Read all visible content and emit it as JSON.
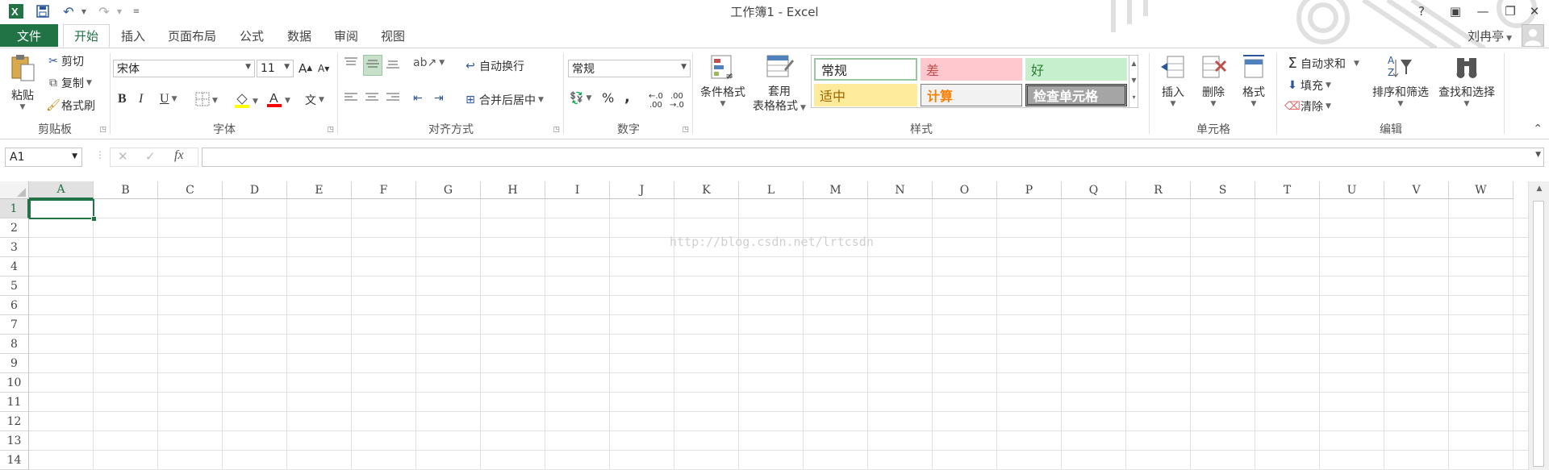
{
  "colors": {
    "accent": "#217346",
    "bad_bg": "#ffc7ce",
    "bad_fg": "#c0504d",
    "good_bg": "#c6efce",
    "neutral_bg": "#ffeb9c",
    "calc_fg": "#fa7d00",
    "check_bg": "#a5a5a5"
  },
  "quick_access": {
    "icons": [
      "excel-logo-icon",
      "save-icon",
      "undo-icon",
      "redo-icon",
      "customize-icon"
    ]
  },
  "window": {
    "title": "工作簿1 - Excel",
    "help": "?",
    "ribbon_display": "▣",
    "minimize": "—",
    "restore": "❐",
    "close": "✕"
  },
  "tabs": {
    "file": "文件",
    "items": [
      "开始",
      "插入",
      "页面布局",
      "公式",
      "数据",
      "审阅",
      "视图"
    ]
  },
  "user": {
    "name": "刘冉亭"
  },
  "ribbon": {
    "clipboard": {
      "paste": "粘贴",
      "cut": "剪切",
      "copy": "复制",
      "format_painter": "格式刷",
      "label": "剪贴板"
    },
    "font": {
      "name": "宋体",
      "size": "11",
      "grow": "A",
      "shrink": "A",
      "bold": "B",
      "italic": "I",
      "underline": "U",
      "phonetic": "文",
      "label": "字体"
    },
    "alignment": {
      "wrap_text": "自动换行",
      "merge_center": "合并后居中",
      "label": "对齐方式"
    },
    "number": {
      "format": "常规",
      "percent": "%",
      "comma": ",",
      "label": "数字"
    },
    "styles": {
      "conditional_formatting": "条件格式",
      "format_as_table_1": "套用",
      "format_as_table_2": "表格格式",
      "cells": [
        "常规",
        "差",
        "好",
        "适中",
        "计算",
        "检查单元格"
      ],
      "label": "样式"
    },
    "cells": {
      "insert": "插入",
      "delete": "删除",
      "format": "格式",
      "label": "单元格"
    },
    "editing": {
      "autosum": "自动求和",
      "fill": "填充",
      "clear": "清除",
      "sort_filter": "排序和筛选",
      "find_select": "查找和选择",
      "label": "编辑"
    }
  },
  "formula_bar": {
    "name_box": "A1",
    "cancel": "✕",
    "enter": "✓",
    "fx": "fx",
    "value": ""
  },
  "sheet": {
    "columns": [
      "A",
      "B",
      "C",
      "D",
      "E",
      "F",
      "G",
      "H",
      "I",
      "J",
      "K",
      "L",
      "M",
      "N",
      "O",
      "P",
      "Q",
      "R",
      "S",
      "T",
      "U",
      "V",
      "W"
    ],
    "rows": [
      "1",
      "2",
      "3",
      "4",
      "5",
      "6",
      "7",
      "8",
      "9",
      "10",
      "11",
      "12",
      "13",
      "14"
    ],
    "active_cell": "A1",
    "watermark": "http://blog.csdn.net/lrtcsdn"
  }
}
